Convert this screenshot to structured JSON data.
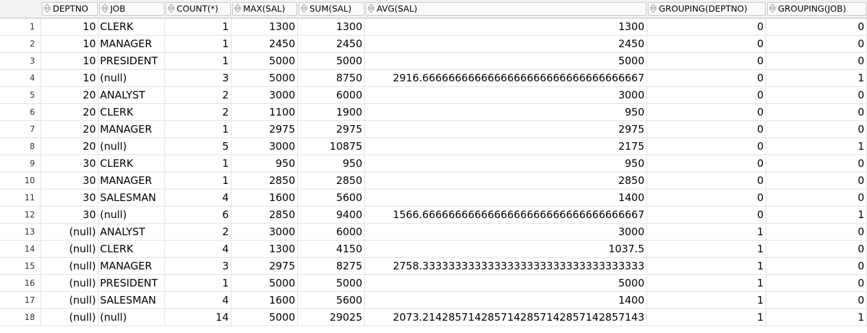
{
  "columns": [
    "DEPTNO",
    "JOB",
    "COUNT(*)",
    "MAX(SAL)",
    "SUM(SAL)",
    "AVG(SAL)",
    "GROUPING(DEPTNO)",
    "GROUPING(JOB)"
  ],
  "rows": [
    [
      "1",
      "10",
      "CLERK",
      "1",
      "1300",
      "1300",
      "1300",
      "0",
      "0"
    ],
    [
      "2",
      "10",
      "MANAGER",
      "1",
      "2450",
      "2450",
      "2450",
      "0",
      "0"
    ],
    [
      "3",
      "10",
      "PRESIDENT",
      "1",
      "5000",
      "5000",
      "5000",
      "0",
      "0"
    ],
    [
      "4",
      "10",
      "(null)",
      "3",
      "5000",
      "8750",
      "2916.6666666666666666666666666666666667",
      "0",
      "1"
    ],
    [
      "5",
      "20",
      "ANALYST",
      "2",
      "3000",
      "6000",
      "3000",
      "0",
      "0"
    ],
    [
      "6",
      "20",
      "CLERK",
      "2",
      "1100",
      "1900",
      "950",
      "0",
      "0"
    ],
    [
      "7",
      "20",
      "MANAGER",
      "1",
      "2975",
      "2975",
      "2975",
      "0",
      "0"
    ],
    [
      "8",
      "20",
      "(null)",
      "5",
      "3000",
      "10875",
      "2175",
      "0",
      "1"
    ],
    [
      "9",
      "30",
      "CLERK",
      "1",
      "950",
      "950",
      "950",
      "0",
      "0"
    ],
    [
      "10",
      "30",
      "MANAGER",
      "1",
      "2850",
      "2850",
      "2850",
      "0",
      "0"
    ],
    [
      "11",
      "30",
      "SALESMAN",
      "4",
      "1600",
      "5600",
      "1400",
      "0",
      "0"
    ],
    [
      "12",
      "30",
      "(null)",
      "6",
      "2850",
      "9400",
      "1566.6666666666666666666666666666666667",
      "0",
      "1"
    ],
    [
      "13",
      "(null)",
      "ANALYST",
      "2",
      "3000",
      "6000",
      "3000",
      "1",
      "0"
    ],
    [
      "14",
      "(null)",
      "CLERK",
      "4",
      "1300",
      "4150",
      "1037.5",
      "1",
      "0"
    ],
    [
      "15",
      "(null)",
      "MANAGER",
      "3",
      "2975",
      "8275",
      "2758.3333333333333333333333333333333333",
      "1",
      "0"
    ],
    [
      "16",
      "(null)",
      "PRESIDENT",
      "1",
      "5000",
      "5000",
      "5000",
      "1",
      "0"
    ],
    [
      "17",
      "(null)",
      "SALESMAN",
      "4",
      "1600",
      "5600",
      "1400",
      "1",
      "0"
    ],
    [
      "18",
      "(null)",
      "(null)",
      "14",
      "5000",
      "29025",
      "2073.2142857142857142857142857142857143",
      "1",
      "1"
    ]
  ]
}
